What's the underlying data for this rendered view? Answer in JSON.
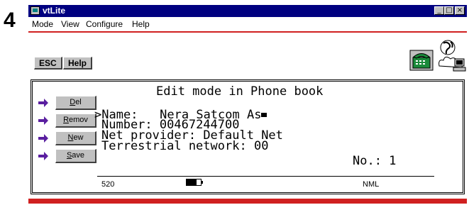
{
  "step_number": "4",
  "window": {
    "title": "vtLite",
    "controls": [
      "_",
      "□",
      "×"
    ]
  },
  "menu": [
    "Mode",
    "View",
    "Configure",
    "Help"
  ],
  "toolbar": {
    "esc_label": "ESC",
    "help_label": "Help",
    "icons": [
      "phone-handset-icon",
      "globe-computer-icon"
    ]
  },
  "side_buttons": [
    {
      "label": "Del",
      "underline": "D"
    },
    {
      "label": "Remov",
      "underline": "R"
    },
    {
      "label": "New",
      "underline": "N"
    },
    {
      "label": "Save",
      "underline": "S"
    }
  ],
  "display": {
    "title": "Edit mode in Phone book",
    "selector": ">",
    "lines": [
      {
        "label": "Name:",
        "value": "Nera Satcom As"
      },
      {
        "label": "Number:",
        "value": "00467244700"
      },
      {
        "label": "Net provider:",
        "value": "Default Net"
      },
      {
        "label": "Terrestrial network:",
        "value": "00"
      }
    ],
    "record": "No.: 1"
  },
  "status": {
    "channel": "520",
    "battery_level": 0.7,
    "mode": "NML"
  },
  "colors": {
    "titlebar": "#000080",
    "accent_red": "#d02020",
    "arrow": "#5a1fa0",
    "button_face": "#c0c0c0"
  }
}
